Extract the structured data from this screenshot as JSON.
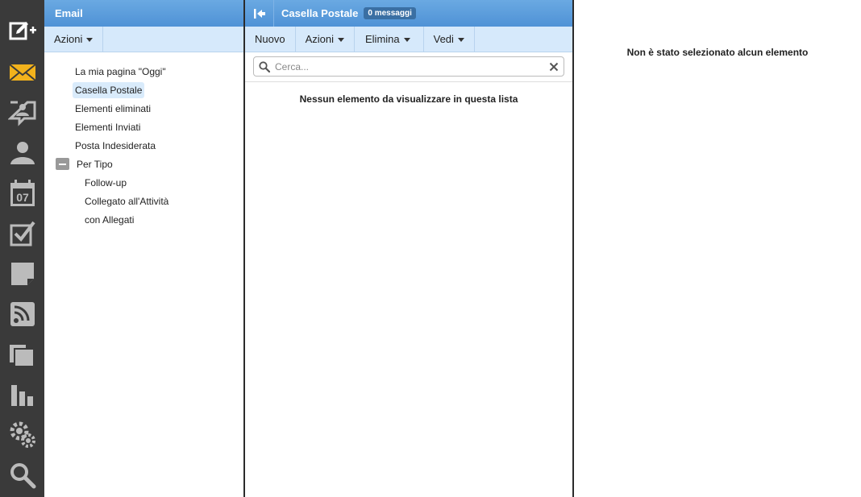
{
  "rail": {
    "items": [
      {
        "icon": "compose-icon"
      },
      {
        "icon": "mail-icon"
      },
      {
        "icon": "chat-icon"
      },
      {
        "icon": "contacts-icon"
      },
      {
        "icon": "calendar-icon",
        "text": "07"
      },
      {
        "icon": "tasks-icon"
      },
      {
        "icon": "notes-icon"
      },
      {
        "icon": "rss-icon"
      },
      {
        "icon": "files-icon"
      },
      {
        "icon": "reports-icon"
      },
      {
        "icon": "settings-icon"
      },
      {
        "icon": "search-icon"
      }
    ],
    "accent": "#f2b21c"
  },
  "folders": {
    "title": "Email",
    "actions_label": "Azioni",
    "items": [
      {
        "label": "La mia pagina \"Oggi\""
      },
      {
        "label": "Casella Postale",
        "selected": true
      },
      {
        "label": "Elementi eliminati"
      },
      {
        "label": "Elementi Inviati"
      },
      {
        "label": "Posta Indesiderata"
      }
    ],
    "group": {
      "label": "Per Tipo",
      "children": [
        {
          "label": "Follow-up"
        },
        {
          "label": "Collegato all'Attività"
        },
        {
          "label": "con Allegati"
        }
      ]
    }
  },
  "list": {
    "title": "Casella Postale",
    "badge": "0 messaggi",
    "toolbar": {
      "new_label": "Nuovo",
      "actions_label": "Azioni",
      "delete_label": "Elimina",
      "view_label": "Vedi"
    },
    "search": {
      "placeholder": "Cerca...",
      "value": ""
    },
    "empty_text": "Nessun elemento da visualizzare in questa lista"
  },
  "reading": {
    "empty_text": "Non è stato selezionato alcun elemento"
  },
  "colors": {
    "titlebar": "#5a9bdc",
    "toolbar": "#d6e9fb",
    "rail": "#3a3a3a",
    "selection": "#d9ebfb"
  }
}
